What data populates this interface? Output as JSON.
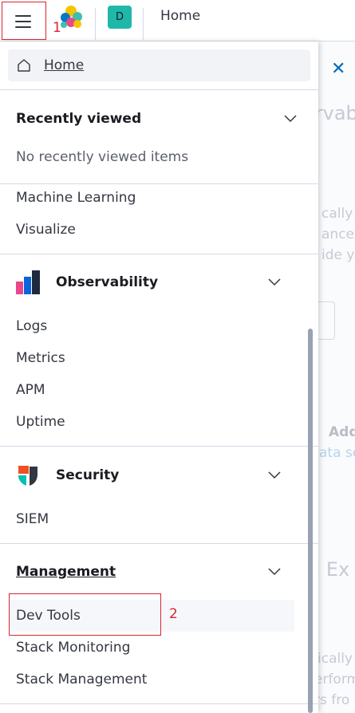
{
  "header": {
    "breadcrumb": "Home",
    "space_initial": "D"
  },
  "annotations": {
    "one": "1",
    "two": "2"
  },
  "background": {
    "texts": [
      "ervab",
      "cally c",
      "ance",
      "ide yo",
      "Add",
      "ata set",
      "d Ex",
      "ically",
      "erform",
      "rs fro"
    ]
  },
  "nav": {
    "home_label": "Home",
    "recently_viewed": {
      "title": "Recently viewed",
      "empty": "No recently viewed items"
    },
    "analytics_items": [
      "Machine Learning",
      "Visualize"
    ],
    "observability": {
      "title": "Observability",
      "items": [
        "Logs",
        "Metrics",
        "APM",
        "Uptime"
      ]
    },
    "security": {
      "title": "Security",
      "items": [
        "SIEM"
      ]
    },
    "management": {
      "title": "Management",
      "items": [
        "Dev Tools",
        "Stack Monitoring",
        "Stack Management"
      ]
    }
  },
  "colors": {
    "accent": "#006bb8",
    "annotation": "#d9252f",
    "avatar": "#1fb8a8"
  }
}
